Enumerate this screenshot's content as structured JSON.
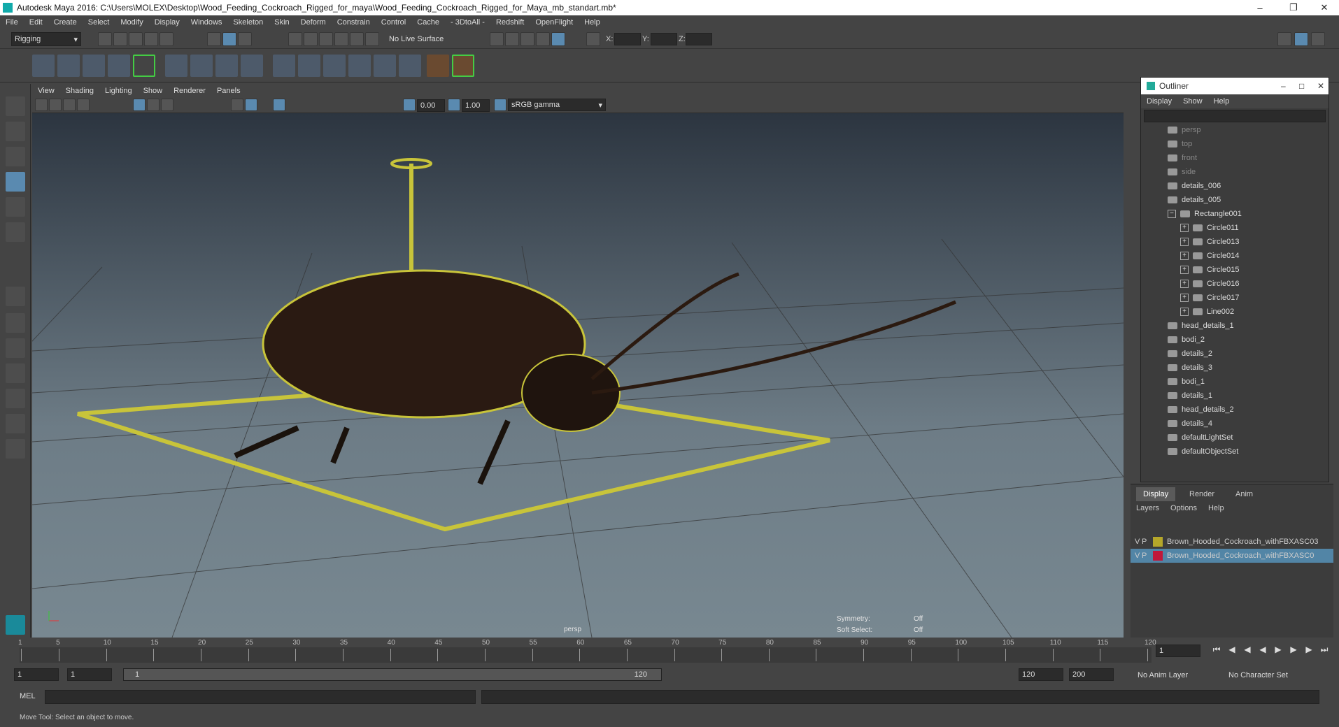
{
  "window": {
    "title": "Autodesk Maya 2016: C:\\Users\\MOLEX\\Desktop\\Wood_Feeding_Cockroach_Rigged_for_maya\\Wood_Feeding_Cockroach_Rigged_for_Maya_mb_standart.mb*"
  },
  "menubar": [
    "File",
    "Edit",
    "Create",
    "Select",
    "Modify",
    "Display",
    "Windows",
    "Skeleton",
    "Skin",
    "Deform",
    "Constrain",
    "Control",
    "Cache",
    "- 3DtoAll -",
    "Redshift",
    "OpenFlight",
    "Help"
  ],
  "shelf": {
    "menuset": "Rigging",
    "live_surface": "No Live Surface",
    "x_label": "X:",
    "y_label": "Y:",
    "z_label": "Z:"
  },
  "panel_menu": [
    "View",
    "Shading",
    "Lighting",
    "Show",
    "Renderer",
    "Panels"
  ],
  "panel_toolbar": {
    "near": "0.00",
    "far": "1.00",
    "color_space": "sRGB gamma"
  },
  "viewport": {
    "camera": "persp",
    "symmetry_label": "Symmetry:",
    "symmetry_value": "Off",
    "soft_select_label": "Soft Select:",
    "soft_select_value": "Off"
  },
  "outliner": {
    "title": "Outliner",
    "menu": [
      "Display",
      "Show",
      "Help"
    ],
    "items": [
      {
        "label": "persp",
        "dim": true,
        "indent": 0
      },
      {
        "label": "top",
        "dim": true,
        "indent": 0
      },
      {
        "label": "front",
        "dim": true,
        "indent": 0
      },
      {
        "label": "side",
        "dim": true,
        "indent": 0
      },
      {
        "label": "details_006",
        "indent": 0
      },
      {
        "label": "details_005",
        "indent": 0
      },
      {
        "label": "Rectangle001",
        "indent": 0,
        "expanded": true
      },
      {
        "label": "Circle011",
        "indent": 1
      },
      {
        "label": "Circle013",
        "indent": 1
      },
      {
        "label": "Circle014",
        "indent": 1
      },
      {
        "label": "Circle015",
        "indent": 1
      },
      {
        "label": "Circle016",
        "indent": 1
      },
      {
        "label": "Circle017",
        "indent": 1
      },
      {
        "label": "Line002",
        "indent": 1
      },
      {
        "label": "head_details_1",
        "indent": 0
      },
      {
        "label": "bodi_2",
        "indent": 0
      },
      {
        "label": "details_2",
        "indent": 0
      },
      {
        "label": "details_3",
        "indent": 0
      },
      {
        "label": "bodi_1",
        "indent": 0
      },
      {
        "label": "details_1",
        "indent": 0
      },
      {
        "label": "head_details_2",
        "indent": 0
      },
      {
        "label": "details_4",
        "indent": 0
      },
      {
        "label": "defaultLightSet",
        "indent": 0
      },
      {
        "label": "defaultObjectSet",
        "indent": 0
      }
    ]
  },
  "layer_editor": {
    "tabs": [
      "Display",
      "Render",
      "Anim"
    ],
    "menu": [
      "Layers",
      "Options",
      "Help"
    ],
    "layers": [
      {
        "v": "V",
        "p": "P",
        "color": "#b5a72a",
        "name": "Brown_Hooded_Cockroach_withFBXASC03"
      },
      {
        "v": "V",
        "p": "P",
        "color": "#c0183a",
        "name": "Brown_Hooded_Cockroach_withFBXASC0"
      }
    ]
  },
  "timeline": {
    "ticks": [
      "1",
      "5",
      "10",
      "15",
      "20",
      "25",
      "30",
      "35",
      "40",
      "45",
      "50",
      "55",
      "60",
      "65",
      "70",
      "75",
      "80",
      "85",
      "90",
      "95",
      "100",
      "105",
      "110",
      "115",
      "120"
    ],
    "current_frame": "1"
  },
  "range": {
    "start": "1",
    "anim_start": "1",
    "slider_start": "1",
    "slider_end": "120",
    "end": "120",
    "anim_end": "200",
    "anim_layer": "No Anim Layer",
    "char_set": "No Character Set"
  },
  "mel": {
    "label": "MEL"
  },
  "status": {
    "help": "Move Tool: Select an object to move."
  }
}
